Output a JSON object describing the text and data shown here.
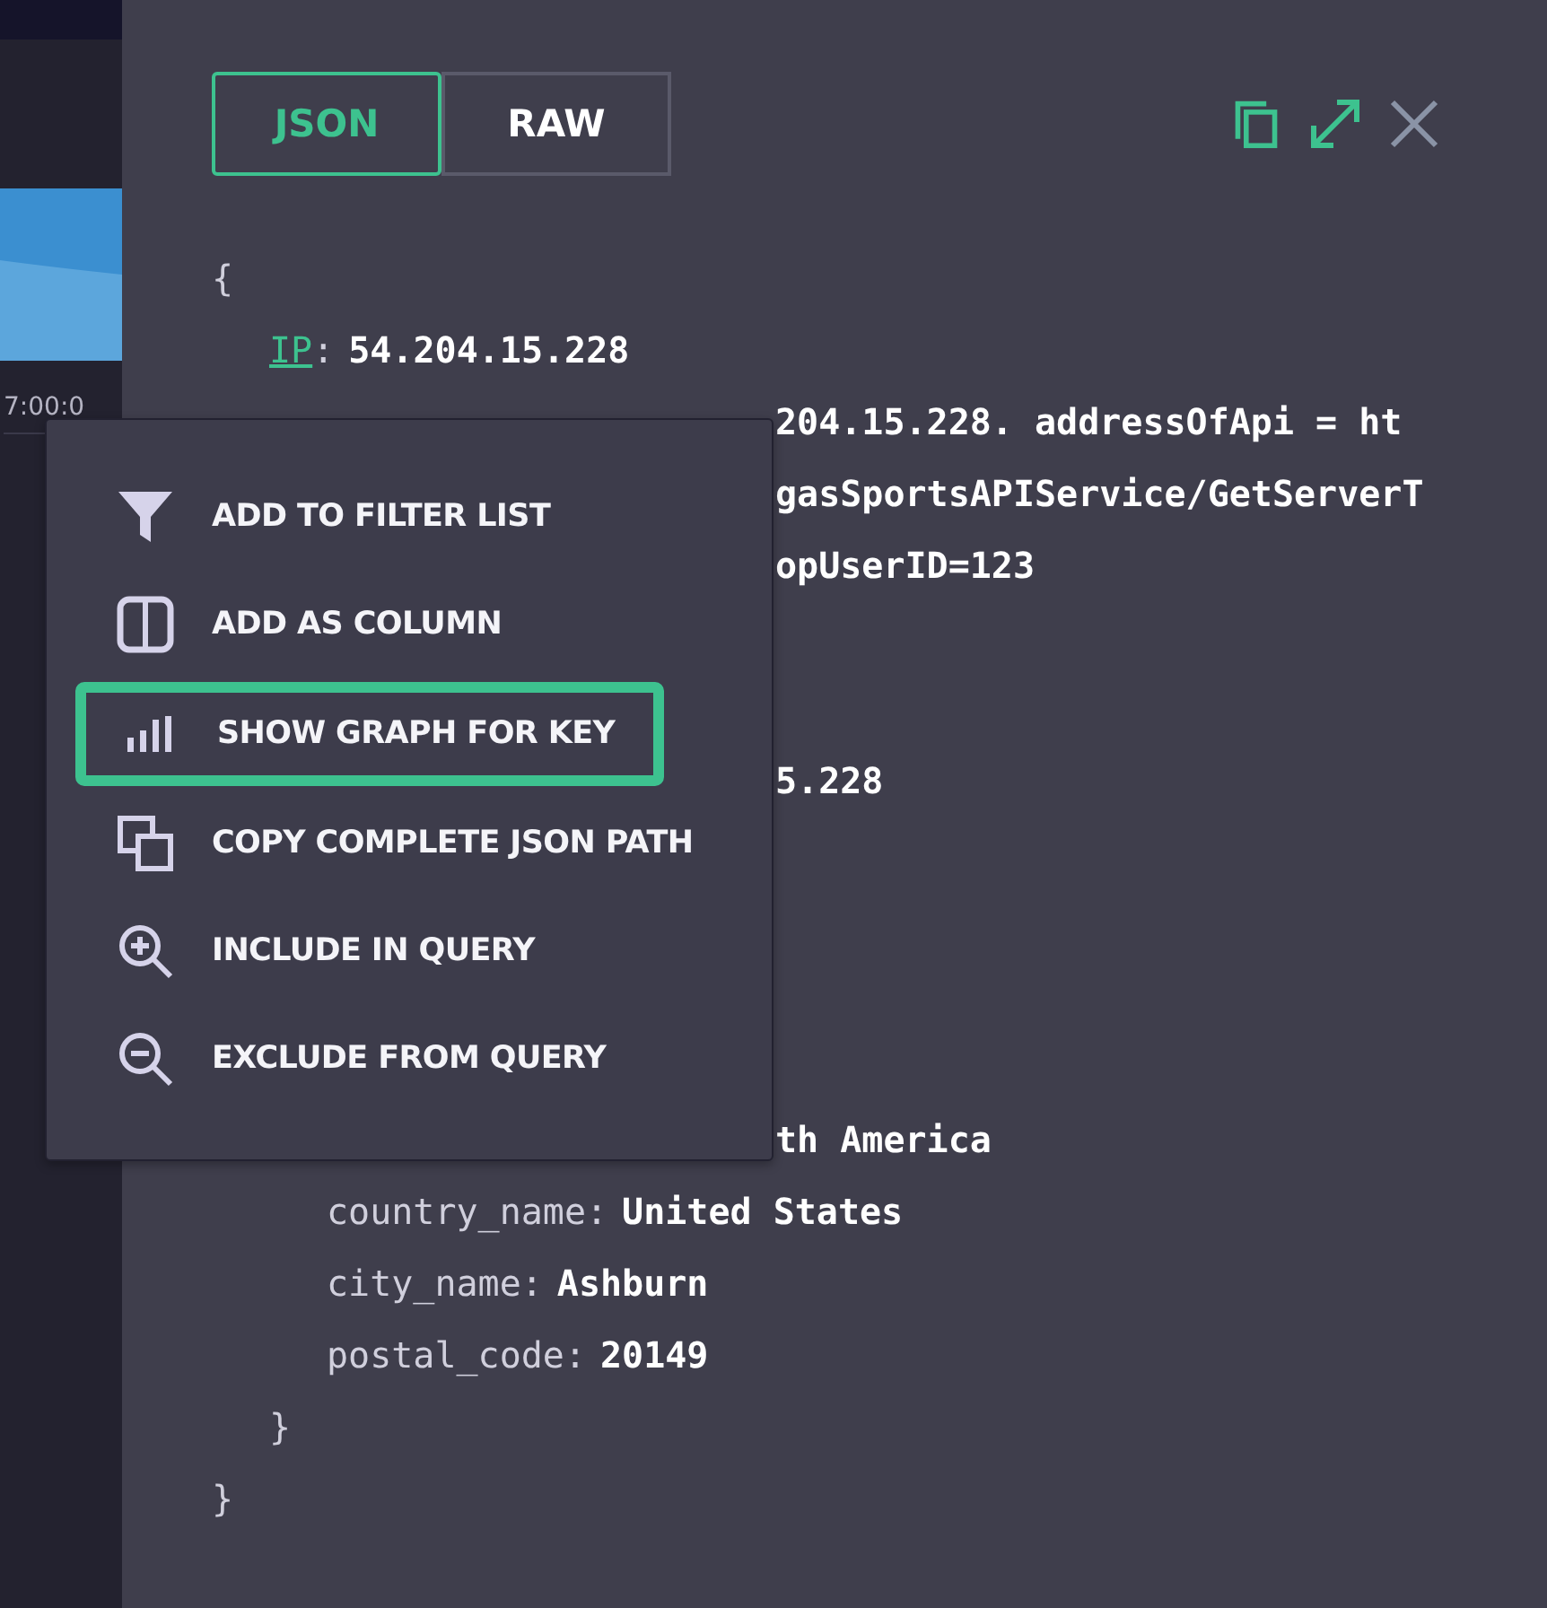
{
  "background": {
    "axis_label": "7:00:0"
  },
  "viewer": {
    "tabs": [
      {
        "label": "JSON",
        "selected": true
      },
      {
        "label": "RAW",
        "selected": false
      }
    ],
    "document": {
      "open": "{",
      "close": "}",
      "children": [
        {
          "kind": "pair",
          "key": "IP",
          "separator": ":",
          "value": "54.204.15.228",
          "link": true
        },
        {
          "kind": "fragment",
          "text": "204.15.228. addressOfApi = ht"
        },
        {
          "kind": "fragment",
          "text": "gasSportsAPIService/GetServerT"
        },
        {
          "kind": "fragment",
          "text": "opUserID=123"
        },
        {
          "kind": "fragment",
          "text": "5.228"
        },
        {
          "kind": "object",
          "close": "}",
          "children": [
            {
              "kind": "fragment",
              "text": "th America"
            },
            {
              "kind": "pair",
              "key": "country_name",
              "separator": ":",
              "value": "United States",
              "link": false
            },
            {
              "kind": "pair",
              "key": "city_name",
              "separator": ":",
              "value": "Ashburn",
              "link": false
            },
            {
              "kind": "pair",
              "key": "postal_code",
              "separator": ":",
              "value": "20149",
              "link": false
            }
          ]
        }
      ]
    }
  },
  "context_menu": {
    "items": [
      {
        "kind": "filter",
        "label": "ADD TO FILTER LIST",
        "selected": false
      },
      {
        "kind": "column",
        "label": "ADD AS COLUMN",
        "selected": false
      },
      {
        "kind": "graph",
        "label": "SHOW GRAPH FOR KEY",
        "selected": true
      },
      {
        "kind": "copy",
        "label": "COPY COMPLETE JSON PATH",
        "selected": false
      },
      {
        "kind": "include",
        "label": "INCLUDE IN QUERY",
        "selected": false
      },
      {
        "kind": "exclude",
        "label": "EXCLUDE FROM QUERY",
        "selected": false
      }
    ]
  }
}
